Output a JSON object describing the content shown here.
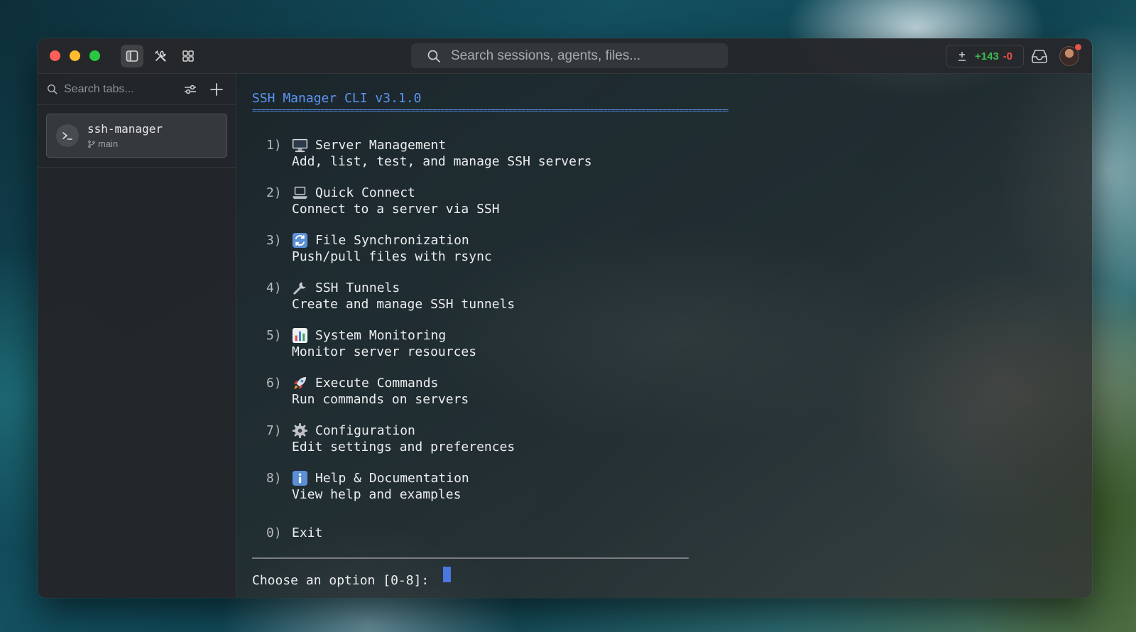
{
  "window": {
    "traffic_lights": [
      "close",
      "minimize",
      "zoom"
    ],
    "toolbar_icons": [
      "sidebar-toggle-icon",
      "tools-icon",
      "grid-icon"
    ]
  },
  "search": {
    "placeholder": "Search sessions, agents, files..."
  },
  "diff": {
    "additions": "+143",
    "deletions": "-0",
    "add_color": "#3fb950",
    "del_color": "#e5534b"
  },
  "sidebar": {
    "search_placeholder": "Search tabs...",
    "tabs": [
      {
        "title": "ssh-manager",
        "branch": "main",
        "active": true
      }
    ]
  },
  "terminal": {
    "title": "SSH Manager CLI v3.1.0",
    "rule": "=================================================================================================================",
    "menu": [
      {
        "num": "1)",
        "icon": "desktop-computer-icon",
        "title": "Server Management",
        "desc": "Add, list, test, and manage SSH servers"
      },
      {
        "num": "2)",
        "icon": "laptop-icon",
        "title": "Quick Connect",
        "desc": "Connect to a server via SSH"
      },
      {
        "num": "3)",
        "icon": "sync-arrows-icon",
        "title": "File Synchronization",
        "desc": "Push/pull files with rsync"
      },
      {
        "num": "4)",
        "icon": "wrench-icon",
        "title": "SSH Tunnels",
        "desc": "Create and manage SSH tunnels"
      },
      {
        "num": "5)",
        "icon": "bar-chart-icon",
        "title": "System Monitoring",
        "desc": "Monitor server resources"
      },
      {
        "num": "6)",
        "icon": "rocket-icon",
        "title": "Execute Commands",
        "desc": "Run commands on servers"
      },
      {
        "num": "7)",
        "icon": "gear-icon",
        "title": "Configuration",
        "desc": "Edit settings and preferences"
      },
      {
        "num": "8)",
        "icon": "info-icon",
        "title": "Help & Documentation",
        "desc": "View help and examples"
      }
    ],
    "exit": {
      "num": "0)",
      "label": "Exit"
    },
    "prompt": "Choose an option [0-8]: ",
    "accent_color": "#5b95f2"
  }
}
